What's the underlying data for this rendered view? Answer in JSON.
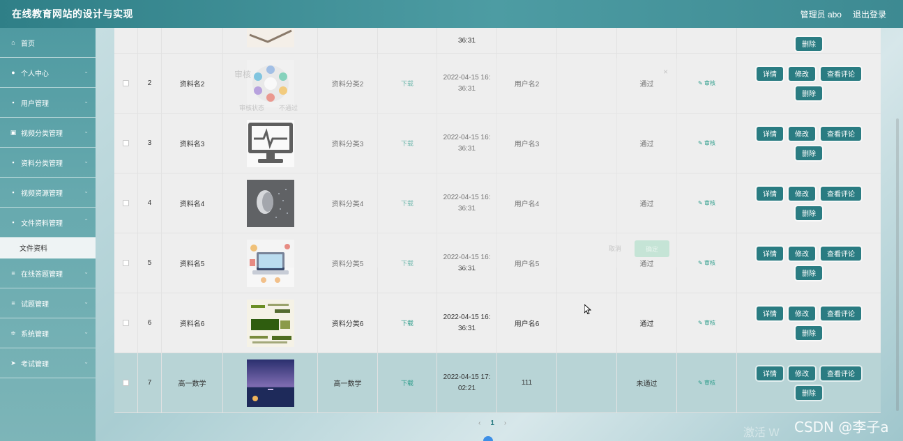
{
  "app": {
    "title": "在线教育网站的设计与实现",
    "user_label": "管理员 abo",
    "logout_label": "退出登录"
  },
  "sidebar": {
    "items": [
      {
        "label": "首页",
        "icon": "home-icon"
      },
      {
        "label": "个人中心",
        "icon": "user-icon"
      },
      {
        "label": "用户管理",
        "icon": "grid-icon"
      },
      {
        "label": "视频分类管理",
        "icon": "list-icon"
      },
      {
        "label": "资料分类管理",
        "icon": "grid-icon"
      },
      {
        "label": "视频资源管理",
        "icon": "grid-icon"
      },
      {
        "label": "文件资料管理",
        "icon": "grid-icon"
      },
      {
        "label": "文件资料",
        "icon": "",
        "sub": true
      },
      {
        "label": "在线答题管理",
        "icon": "list-icon"
      },
      {
        "label": "试题管理",
        "icon": "list-icon"
      },
      {
        "label": "系统管理",
        "icon": "settings-icon"
      },
      {
        "label": "考试管理",
        "icon": "send-icon"
      }
    ]
  },
  "table": {
    "partial_row": {
      "time": "36:31",
      "ops": {
        "delete": "删除"
      }
    },
    "rows": [
      {
        "no": "2",
        "name": "资料名2",
        "category": "资料分类2",
        "download": "下载",
        "time1": "2022-04-15 16:",
        "time2": "36:31",
        "user": "用户名2",
        "extra": "",
        "status": "通过",
        "audit": "审核",
        "thumb": "circle-infographic"
      },
      {
        "no": "3",
        "name": "资料名3",
        "category": "资料分类3",
        "download": "下载",
        "time1": "2022-04-15 16:",
        "time2": "36:31",
        "user": "用户名3",
        "extra": "",
        "status": "通过",
        "audit": "审核",
        "thumb": "monitor-pulse"
      },
      {
        "no": "4",
        "name": "资料名4",
        "category": "资料分类4",
        "download": "下载",
        "time1": "2022-04-15 16:",
        "time2": "36:31",
        "user": "用户名4",
        "extra": "",
        "status": "通过",
        "audit": "审核",
        "thumb": "ai-face"
      },
      {
        "no": "5",
        "name": "资料名5",
        "category": "资料分类5",
        "download": "下载",
        "time1": "2022-04-15 16:",
        "time2": "36:31",
        "user": "用户名5",
        "extra": "",
        "status": "通过",
        "audit": "审核",
        "thumb": "laptop-illustration"
      },
      {
        "no": "6",
        "name": "资料名6",
        "category": "资料分类6",
        "download": "下载",
        "time1": "2022-04-15 16:",
        "time2": "36:31",
        "user": "用户名6",
        "extra": "",
        "status": "通过",
        "audit": "审核",
        "thumb": "java-wordcloud"
      },
      {
        "no": "7",
        "name": "高一数学",
        "category": "高一数学",
        "download": "下载",
        "time1": "2022-04-15 17:",
        "time2": "02:21",
        "user": "111",
        "extra": "",
        "status": "未通过",
        "audit": "审核",
        "thumb": "night-sea"
      }
    ],
    "ops": {
      "detail": "详情",
      "edit": "修改",
      "comments": "查看评论",
      "delete": "删除"
    }
  },
  "dialog": {
    "title": "审核",
    "close": "×",
    "field_label": "审核状态",
    "radio_label": "不通过",
    "cancel": "取消",
    "confirm": "确定"
  },
  "pagination": {
    "prev": "‹",
    "current": "1",
    "next": "›"
  },
  "watermark": {
    "faded": "激活 W",
    "csdn": "CSDN @李子a"
  },
  "colors": {
    "topbar": "#3d8a92",
    "button": "#2a7c82",
    "link": "#2b9c8a",
    "highlight_row": "#b8d4d6"
  }
}
